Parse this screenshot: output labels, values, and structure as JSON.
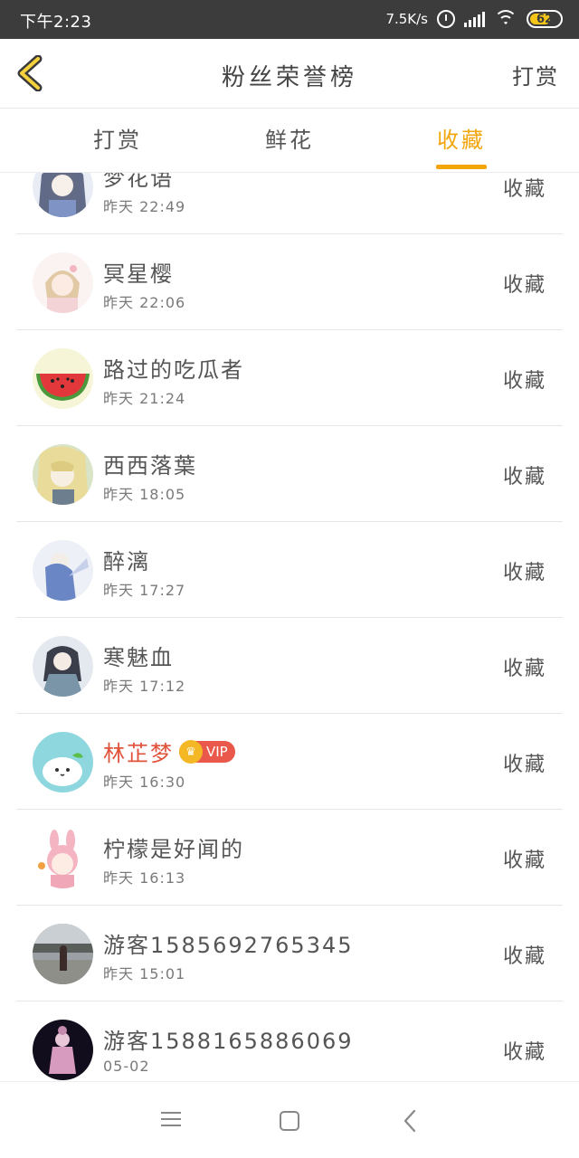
{
  "status_bar": {
    "time": "下午2:23",
    "network_speed": "7.5K/s",
    "battery_level": "62",
    "icons": [
      "alarm-icon",
      "signal-icon",
      "wifi-icon",
      "battery-icon"
    ]
  },
  "header": {
    "title": "粉丝荣誉榜",
    "right_action": "打赏",
    "back_icon": "chevron-left-icon"
  },
  "tabs": [
    {
      "label": "打赏",
      "active": false
    },
    {
      "label": "鲜花",
      "active": false
    },
    {
      "label": "收藏",
      "active": true
    }
  ],
  "accent_color": "#f2a60c",
  "list": [
    {
      "name": "梦花语",
      "time": "昨天 22:49",
      "action": "收藏",
      "vip": false,
      "vip_label": ""
    },
    {
      "name": "冥星樱",
      "time": "昨天 22:06",
      "action": "收藏",
      "vip": false,
      "vip_label": ""
    },
    {
      "name": "路过的吃瓜者",
      "time": "昨天 21:24",
      "action": "收藏",
      "vip": false,
      "vip_label": ""
    },
    {
      "name": "西西落葉",
      "time": "昨天 18:05",
      "action": "收藏",
      "vip": false,
      "vip_label": ""
    },
    {
      "name": "醉漓",
      "time": "昨天 17:27",
      "action": "收藏",
      "vip": false,
      "vip_label": ""
    },
    {
      "name": "寒魅血",
      "time": "昨天 17:12",
      "action": "收藏",
      "vip": false,
      "vip_label": ""
    },
    {
      "name": "林芷梦",
      "time": "昨天 16:30",
      "action": "收藏",
      "vip": true,
      "vip_label": "VIP"
    },
    {
      "name": "柠檬是好闻的",
      "time": "昨天 16:13",
      "action": "收藏",
      "vip": false,
      "vip_label": ""
    },
    {
      "name": "游客1585692765345",
      "time": "昨天 15:01",
      "action": "收藏",
      "vip": false,
      "vip_label": ""
    },
    {
      "name": "游客1588165886069",
      "time": "05-02",
      "action": "收藏",
      "vip": false,
      "vip_label": ""
    }
  ],
  "nav_bar": {
    "icons": [
      "menu-icon",
      "home-icon",
      "back-icon"
    ]
  }
}
